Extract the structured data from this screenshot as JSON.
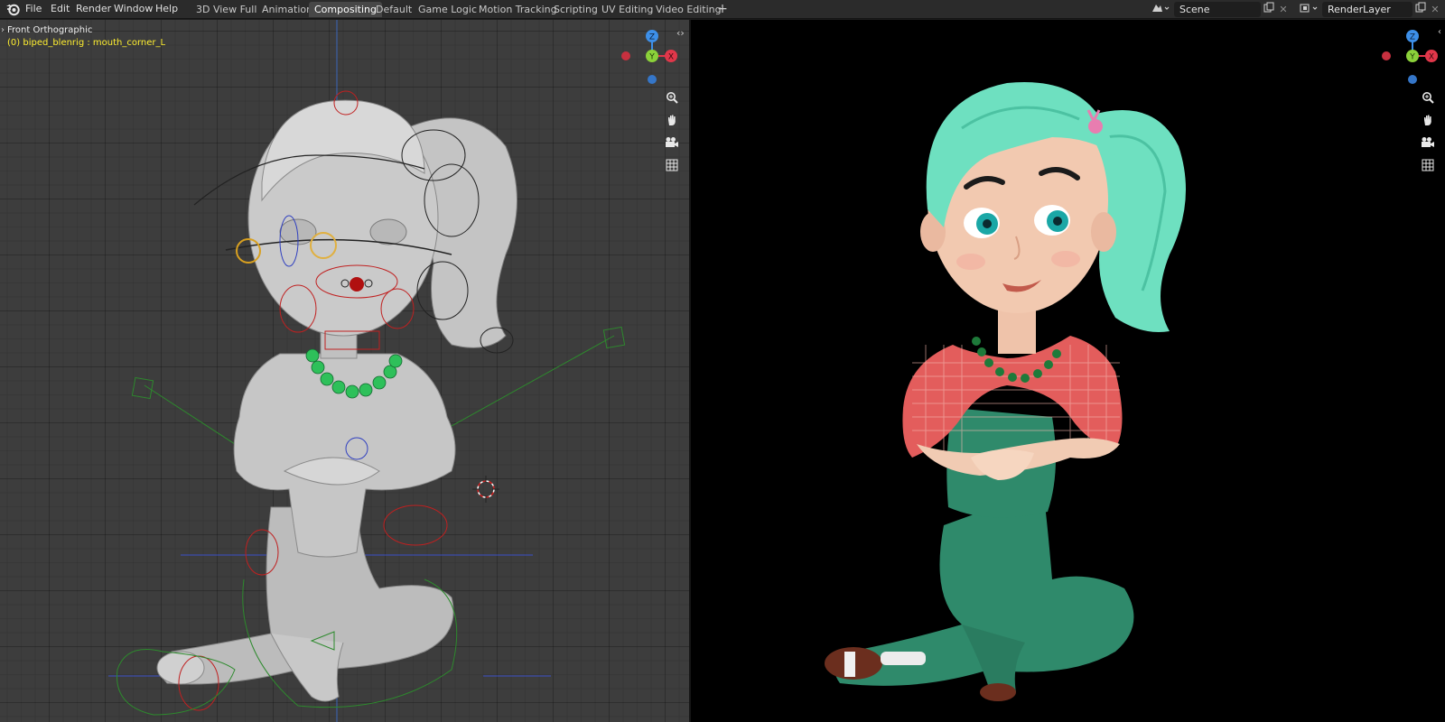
{
  "menu": {
    "items": [
      "File",
      "Edit",
      "Render",
      "Window",
      "Help"
    ]
  },
  "workspaces": {
    "tabs": [
      "3D View Full",
      "Animation",
      "Compositing",
      "Default",
      "Game Logic",
      "Motion Tracking",
      "Scripting",
      "UV Editing",
      "Video Editing"
    ],
    "active": "Compositing",
    "add_label": "+"
  },
  "scene": {
    "name": "Scene",
    "close_label": "✕"
  },
  "render_layer": {
    "name": "RenderLayer",
    "close_label": "✕"
  },
  "viewport": {
    "view_name": "Front Orthographic",
    "active_object": "(0) biped_blenrig : mouth_corner_L"
  },
  "gizmo": {
    "z_label": "Z",
    "y_label": "Y",
    "x_label": "X"
  },
  "colors": {
    "gizmo_x": "#e0374a",
    "gizmo_y": "#8bd13a",
    "gizmo_z": "#3d8fe8",
    "active_tab": "#474747",
    "header_text_yellow": "#ffef30",
    "hair": "#6ee0c0",
    "shirt": "#e85a5a",
    "overalls": "#3a9a78"
  },
  "icons": {
    "logo": "blender-logo-icon",
    "zoom": "zoom-icon",
    "pan": "hand-icon",
    "camera": "camera-icon",
    "grid": "grid-icon"
  }
}
